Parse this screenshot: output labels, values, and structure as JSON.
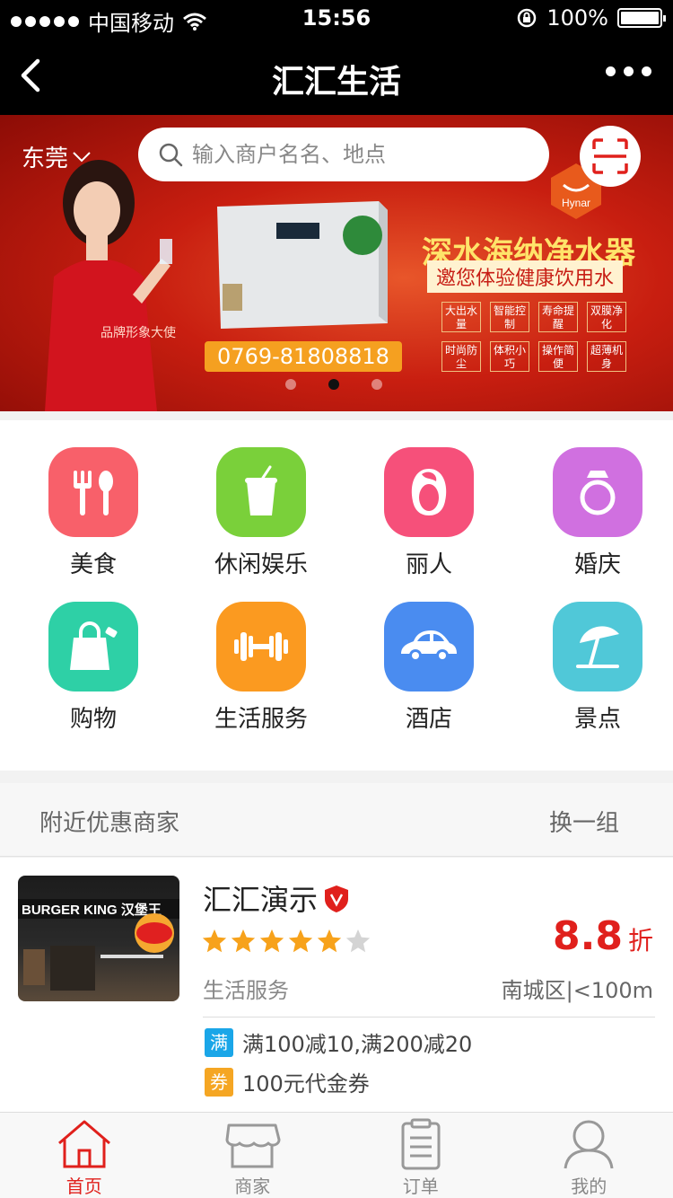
{
  "status_bar": {
    "carrier": "中国移动",
    "time": "15:56",
    "battery": "100%",
    "battery_level": 1.0
  },
  "nav": {
    "title": "汇汇生活"
  },
  "banner": {
    "city": "东莞",
    "search_placeholder": "输入商户名名、地点",
    "ad": {
      "brand": "Hynar",
      "headline": "深水海纳净水器",
      "subline": "邀您体验健康饮用水",
      "phone": "0769-81808818",
      "ambassador": "品牌形象大使",
      "features": [
        "大出水量",
        "智能控制",
        "寿命提醒",
        "双膜净化",
        "时尚防尘",
        "体积小巧",
        "操作简便",
        "超薄机身"
      ]
    },
    "slide_count": 3,
    "active_slide": 2
  },
  "categories": [
    {
      "label": "美食",
      "icon": "fork-spoon-icon",
      "color": "#f8606a"
    },
    {
      "label": "休闲娱乐",
      "icon": "drink-cup-icon",
      "color": "#7ad03a"
    },
    {
      "label": "丽人",
      "icon": "woman-hair-icon",
      "color": "#f6507a"
    },
    {
      "label": "婚庆",
      "icon": "ring-icon",
      "color": "#d070e0"
    },
    {
      "label": "购物",
      "icon": "shopping-bag-icon",
      "color": "#2ed0a6"
    },
    {
      "label": "生活服务",
      "icon": "dumbbell-icon",
      "color": "#fb9a20"
    },
    {
      "label": "酒店",
      "icon": "car-icon",
      "color": "#4a8cf0"
    },
    {
      "label": "景点",
      "icon": "beach-umbrella-icon",
      "color": "#50c8d8"
    }
  ],
  "nearby": {
    "title": "附近优惠商家",
    "switch_label": "换一组"
  },
  "merchant": {
    "name": "汇汇演示",
    "rating": 5,
    "rating_max": 6,
    "category": "生活服务",
    "discount": "8.8",
    "discount_unit": "折",
    "location": "南城区|<100m",
    "thumb_sign": "BURGER KING 汉堡王",
    "promos": [
      {
        "tag": "满",
        "text": "满100减10,满200减20",
        "color": "#1aa6e8"
      },
      {
        "tag": "券",
        "text": "100元代金券",
        "color": "#f5a623"
      }
    ]
  },
  "tabs": [
    {
      "label": "首页",
      "icon": "home-icon",
      "active": true
    },
    {
      "label": "商家",
      "icon": "store-icon",
      "active": false
    },
    {
      "label": "订单",
      "icon": "order-list-icon",
      "active": false
    },
    {
      "label": "我的",
      "icon": "user-icon",
      "active": false
    }
  ],
  "colors": {
    "accent": "#e0201c",
    "nav_bg": "#000000"
  }
}
